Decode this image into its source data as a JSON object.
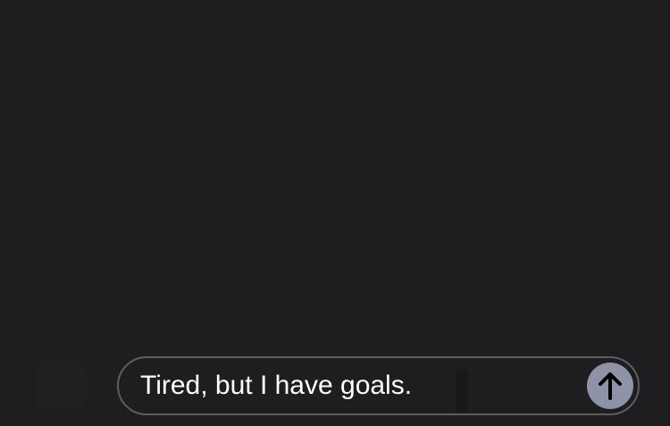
{
  "composer": {
    "text": "Tired, but I have goals."
  },
  "send_button": {
    "icon": "arrow-up-icon"
  },
  "colors": {
    "background": "#1e1e20",
    "composer_border": "#5d5d61",
    "send_button": "#8f93a8",
    "text": "#ffffff"
  }
}
